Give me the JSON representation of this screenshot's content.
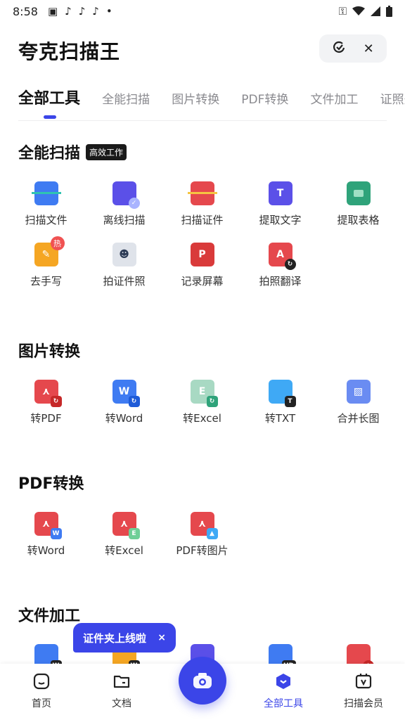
{
  "status_bar": {
    "time": "8:58",
    "icons": [
      "image-icon",
      "music-icon",
      "tiktok-icon",
      "tiktok-icon",
      "dot-icon"
    ],
    "right_icons": [
      "key-icon",
      "wifi-icon",
      "signal-icon",
      "battery-icon"
    ]
  },
  "header": {
    "title": "夸克扫描王",
    "capsule_icons": [
      "refresh-icon",
      "close-icon"
    ],
    "close_glyph": "✕"
  },
  "tabs": [
    {
      "label": "全部工具",
      "active": true
    },
    {
      "label": "全能扫描"
    },
    {
      "label": "图片转换"
    },
    {
      "label": "PDF转换"
    },
    {
      "label": "文件加工"
    },
    {
      "label": "证照美"
    }
  ],
  "sections": {
    "scan": {
      "title": "全能扫描",
      "badge": "高效工作",
      "items": [
        {
          "label": "扫描文件",
          "icon": "scan-file-icon"
        },
        {
          "label": "离线扫描",
          "icon": "offline-scan-icon"
        },
        {
          "label": "扫描证件",
          "icon": "scan-id-icon"
        },
        {
          "label": "提取文字",
          "icon": "extract-text-icon"
        },
        {
          "label": "提取表格",
          "icon": "extract-table-icon"
        },
        {
          "label": "去手写",
          "icon": "remove-handwriting-icon",
          "hot": "热"
        },
        {
          "label": "拍证件照",
          "icon": "id-photo-icon"
        },
        {
          "label": "记录屏幕",
          "icon": "record-screen-icon"
        },
        {
          "label": "拍照翻译",
          "icon": "photo-translate-icon"
        }
      ]
    },
    "image": {
      "title": "图片转换",
      "items": [
        {
          "label": "转PDF",
          "icon": "to-pdf-icon"
        },
        {
          "label": "转Word",
          "icon": "to-word-icon"
        },
        {
          "label": "转Excel",
          "icon": "to-excel-icon"
        },
        {
          "label": "转TXT",
          "icon": "to-txt-icon"
        },
        {
          "label": "合并长图",
          "icon": "merge-image-icon"
        }
      ]
    },
    "pdf": {
      "title": "PDF转换",
      "items": [
        {
          "label": "转Word",
          "icon": "pdf-to-word-icon"
        },
        {
          "label": "转Excel",
          "icon": "pdf-to-excel-icon"
        },
        {
          "label": "PDF转图片",
          "icon": "pdf-to-image-icon"
        }
      ]
    },
    "file": {
      "title": "文件加工"
    }
  },
  "toast": {
    "text": "证件夹上线啦",
    "close": "×"
  },
  "bottom_nav": [
    {
      "label": "首页",
      "icon": "home-icon"
    },
    {
      "label": "文档",
      "icon": "folder-icon"
    },
    {
      "label": "全部工具",
      "icon": "all-tools-icon",
      "active": true
    },
    {
      "label": "扫描会员",
      "icon": "vip-icon"
    }
  ],
  "fab": {
    "icon": "camera-icon"
  },
  "colors": {
    "accent": "#3b45e8",
    "red": "#e5484d",
    "blue": "#3f7bf2",
    "green": "#2fa37a",
    "orange": "#f5a623",
    "purple": "#5b50e8"
  }
}
